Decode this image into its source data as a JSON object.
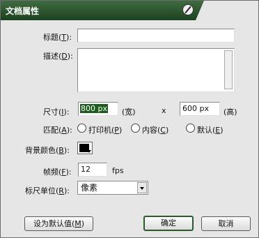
{
  "dialog": {
    "title": "文档属性"
  },
  "fields": {
    "title_label": "标题(",
    "title_key": "T",
    "title_end": "):",
    "title_value": "",
    "desc_label": "描述(",
    "desc_key": "D",
    "desc_end": "):",
    "desc_value": "",
    "size_label": "尺寸(",
    "size_key": "I",
    "size_end": "):",
    "width_value": "800 px",
    "width_unit": "(宽)",
    "times": "x",
    "height_value": "600 px",
    "height_unit": "(高)",
    "match_label": "匹配(",
    "match_key": "A",
    "match_end": "):",
    "radio_printer_a": "打印机(",
    "radio_printer_key": "P",
    "radio_printer_b": ")",
    "radio_content_a": "内容(",
    "radio_content_key": "C",
    "radio_content_b": ")",
    "radio_default_a": "默认(",
    "radio_default_key": "E",
    "radio_default_b": ")",
    "bg_label": "背景颜色(",
    "bg_key": "B",
    "bg_end": "):",
    "bg_color": "#000000",
    "fps_label": "帧频(",
    "fps_key": "F",
    "fps_end": "):",
    "fps_value": "12",
    "fps_unit": "fps",
    "ruler_label": "标尺单位(",
    "ruler_key": "R",
    "ruler_end": "):",
    "ruler_value": "像素"
  },
  "buttons": {
    "make_default_a": "设为默认值(",
    "make_default_key": "M",
    "make_default_b": ")",
    "ok": "确定",
    "cancel": "取消"
  }
}
